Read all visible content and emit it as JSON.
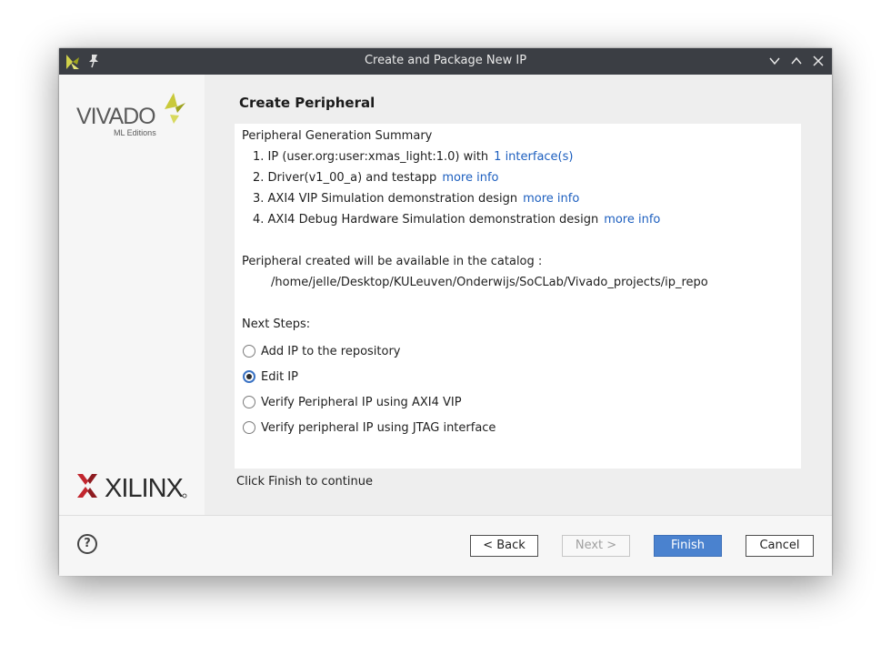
{
  "window": {
    "title": "Create and Package New IP",
    "icons": [
      "vivado-app-icon",
      "pin-icon",
      "chevron-down-icon",
      "chevron-up-icon",
      "close-icon"
    ]
  },
  "sidebar": {
    "vivado_logo": {
      "word": "VIVADO",
      "tagline": "ML Editions"
    },
    "xilinx_logo": {
      "word": "XILINX"
    }
  },
  "main": {
    "heading": "Create Peripheral",
    "summary_title": "Peripheral Generation Summary",
    "summary_items": [
      {
        "text": "1. IP (user.org:user:xmas_light:1.0) with",
        "link": "1 interface(s)"
      },
      {
        "text": "2. Driver(v1_00_a) and testapp",
        "link": "more info"
      },
      {
        "text": "3. AXI4 VIP Simulation demonstration design",
        "link": "more info"
      },
      {
        "text": "4. AXI4 Debug Hardware Simulation demonstration design",
        "link": "more info"
      }
    ],
    "catalog_label": "Peripheral created will be available in the catalog :",
    "catalog_path": "/home/jelle/Desktop/KULeuven/Onderwijs/SoCLab/Vivado_projects/ip_repo",
    "next_steps_label": "Next Steps:",
    "options": [
      {
        "label": "Add IP to the repository",
        "checked": false
      },
      {
        "label": "Edit IP",
        "checked": true
      },
      {
        "label": "Verify Peripheral IP using AXI4 VIP",
        "checked": false
      },
      {
        "label": "Verify peripheral IP using JTAG interface",
        "checked": false
      }
    ],
    "footer_note": "Click Finish to continue"
  },
  "buttons": {
    "help": "?",
    "back": "< Back",
    "next": "Next >",
    "finish": "Finish",
    "cancel": "Cancel"
  },
  "colors": {
    "titlebar": "#3b3e44",
    "link": "#1d5fbf",
    "primary_button": "#4a82cf",
    "vivado_green": "#b5b62a",
    "xilinx_red": "#c2262e"
  }
}
